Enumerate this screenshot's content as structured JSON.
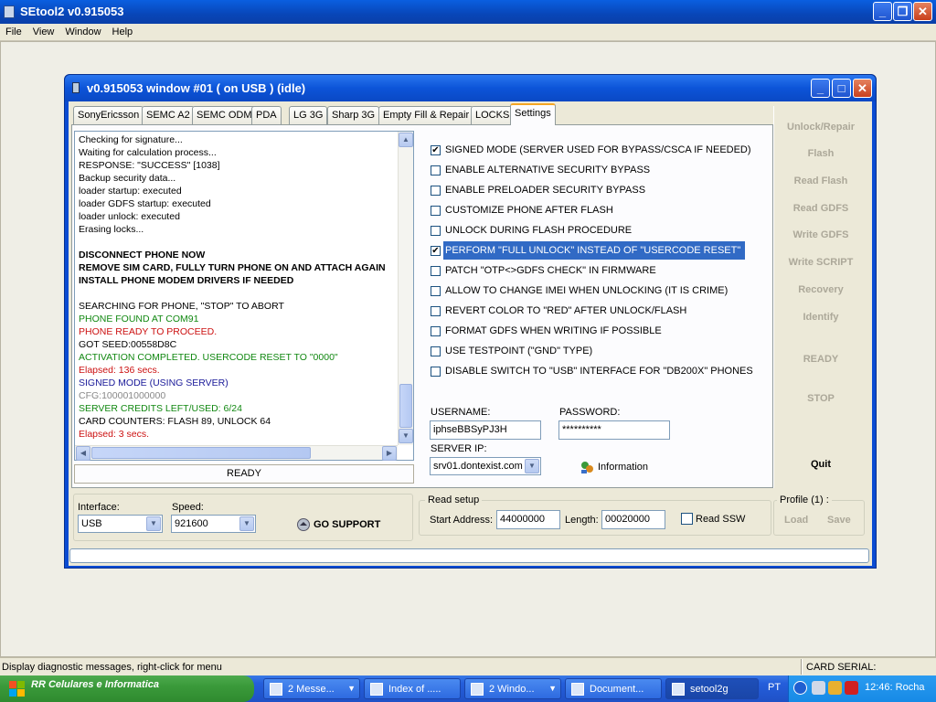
{
  "app": {
    "title": "SEtool2 v0.915053",
    "menu": [
      "File",
      "View",
      "Window",
      "Help"
    ],
    "status_message": "Display diagnostic messages, right-click for menu",
    "card_serial_label": "CARD SERIAL:"
  },
  "window": {
    "title": "v0.915053 window #01 ( on USB ) (idle)",
    "tabs": [
      "SonyEricsson",
      "SEMC A2",
      "SEMC ODM",
      "PDA",
      "LG 3G",
      "Sharp 3G",
      "Empty Fill & Repair",
      "LOCKS",
      "Settings"
    ],
    "selected_tab": "Settings"
  },
  "log": {
    "lines": [
      {
        "text": "Checking for signature...",
        "color": "#000000",
        "bold": false
      },
      {
        "text": "Waiting for calculation process...",
        "color": "#000000",
        "bold": false
      },
      {
        "text": "RESPONSE: \"SUCCESS\" [1038]",
        "color": "#000000",
        "bold": false
      },
      {
        "text": "Backup security data...",
        "color": "#000000",
        "bold": false
      },
      {
        "text": "loader startup: executed",
        "color": "#000000",
        "bold": false
      },
      {
        "text": "loader GDFS startup: executed",
        "color": "#000000",
        "bold": false
      },
      {
        "text": "loader unlock: executed",
        "color": "#000000",
        "bold": false
      },
      {
        "text": "Erasing locks...",
        "color": "#000000",
        "bold": false
      },
      {
        "text": "",
        "color": "#000000",
        "bold": false
      },
      {
        "text": "DISCONNECT PHONE NOW",
        "color": "#000000",
        "bold": true
      },
      {
        "text": "REMOVE SIM CARD, FULLY TURN PHONE ON AND ATTACH AGAIN",
        "color": "#000000",
        "bold": true
      },
      {
        "text": "INSTALL PHONE MODEM DRIVERS IF NEEDED",
        "color": "#000000",
        "bold": true
      },
      {
        "text": "",
        "color": "#000000",
        "bold": false
      },
      {
        "text": "SEARCHING FOR PHONE, \"STOP\" TO ABORT",
        "color": "#000000",
        "bold": false
      },
      {
        "text": "PHONE FOUND AT COM91",
        "color": "#118811",
        "bold": false
      },
      {
        "text": "PHONE READY TO PROCEED.",
        "color": "#cc1111",
        "bold": false
      },
      {
        "text": "GOT SEED:00558D8C",
        "color": "#000000",
        "bold": false
      },
      {
        "text": "ACTIVATION COMPLETED. USERCODE RESET TO \"0000\"",
        "color": "#118811",
        "bold": false
      },
      {
        "text": "Elapsed: 136 secs.",
        "color": "#cc1111",
        "bold": false
      },
      {
        "text": "SIGNED MODE (USING SERVER)",
        "color": "#1a1a99",
        "bold": false
      },
      {
        "text": "CFG:100001000000",
        "color": "#888888",
        "bold": false
      },
      {
        "text": "SERVER CREDITS LEFT/USED: 6/24",
        "color": "#118811",
        "bold": false
      },
      {
        "text": "CARD COUNTERS: FLASH 89, UNLOCK 64",
        "color": "#000000",
        "bold": false
      },
      {
        "text": "Elapsed: 3 secs.",
        "color": "#cc1111",
        "bold": false
      }
    ],
    "status": "READY"
  },
  "settings": {
    "options": [
      {
        "label": "SIGNED MODE (SERVER USED FOR BYPASS/CSCA IF NEEDED)",
        "checked": true
      },
      {
        "label": "ENABLE ALTERNATIVE SECURITY BYPASS",
        "checked": false
      },
      {
        "label": "ENABLE PRELOADER SECURITY BYPASS",
        "checked": false
      },
      {
        "label": "CUSTOMIZE PHONE AFTER FLASH",
        "checked": false
      },
      {
        "label": "UNLOCK DURING FLASH PROCEDURE",
        "checked": false
      },
      {
        "label": "PERFORM \"FULL UNLOCK\" INSTEAD OF \"USERCODE RESET\"",
        "checked": true
      },
      {
        "label": "PATCH \"OTP<>GDFS CHECK\" IN FIRMWARE",
        "checked": false
      },
      {
        "label": "ALLOW TO CHANGE IMEI WHEN UNLOCKING (IT IS CRIME)",
        "checked": false
      },
      {
        "label": "REVERT COLOR TO \"RED\" AFTER UNLOCK/FLASH",
        "checked": false
      },
      {
        "label": "FORMAT GDFS WHEN WRITING IF POSSIBLE",
        "checked": false
      },
      {
        "label": "USE TESTPOINT (\"GND\" TYPE)",
        "checked": false
      },
      {
        "label": "DISABLE SWITCH TO \"USB\" INTERFACE FOR \"DB200X\" PHONES",
        "checked": false
      }
    ],
    "username_label": "USERNAME:",
    "username_value": "iphseBBSyPJ3H",
    "password_label": "PASSWORD:",
    "password_value": "**********",
    "server_ip_label": "SERVER IP:",
    "server_ip_value": "srv01.dontexist.com",
    "information_label": "Information"
  },
  "actions": {
    "unlock_repair": "Unlock/Repair",
    "flash": "Flash",
    "read_flash": "Read Flash",
    "read_gdfs": "Read GDFS",
    "write_gdfs": "Write GDFS",
    "write_script": "Write SCRIPT",
    "recovery": "Recovery",
    "identify": "Identify",
    "ready": "READY",
    "stop": "STOP",
    "quit": "Quit"
  },
  "bottom": {
    "interface_label": "Interface:",
    "interface_value": "USB",
    "speed_label": "Speed:",
    "speed_value": "921600",
    "go_support": "GO SUPPORT",
    "read_setup_label": "Read setup",
    "start_address_label": "Start Address:",
    "start_address_value": "44000000",
    "length_label": "Length:",
    "length_value": "00020000",
    "read_ssw_label": "Read SSW",
    "read_ssw_checked": false,
    "profile_label": "Profile (1) :",
    "load": "Load",
    "save": "Save"
  },
  "taskbar": {
    "start_label": "RR Celulares e Informatica",
    "items": [
      {
        "label": "2 Messe...",
        "has_arrow": true
      },
      {
        "label": "Index of .....",
        "has_arrow": false
      },
      {
        "label": "2 Windo...",
        "has_arrow": true
      },
      {
        "label": "Document...",
        "has_arrow": false
      },
      {
        "label": "setool2g",
        "has_arrow": false
      }
    ],
    "language": "PT",
    "clock": "12:46: Rocha"
  }
}
